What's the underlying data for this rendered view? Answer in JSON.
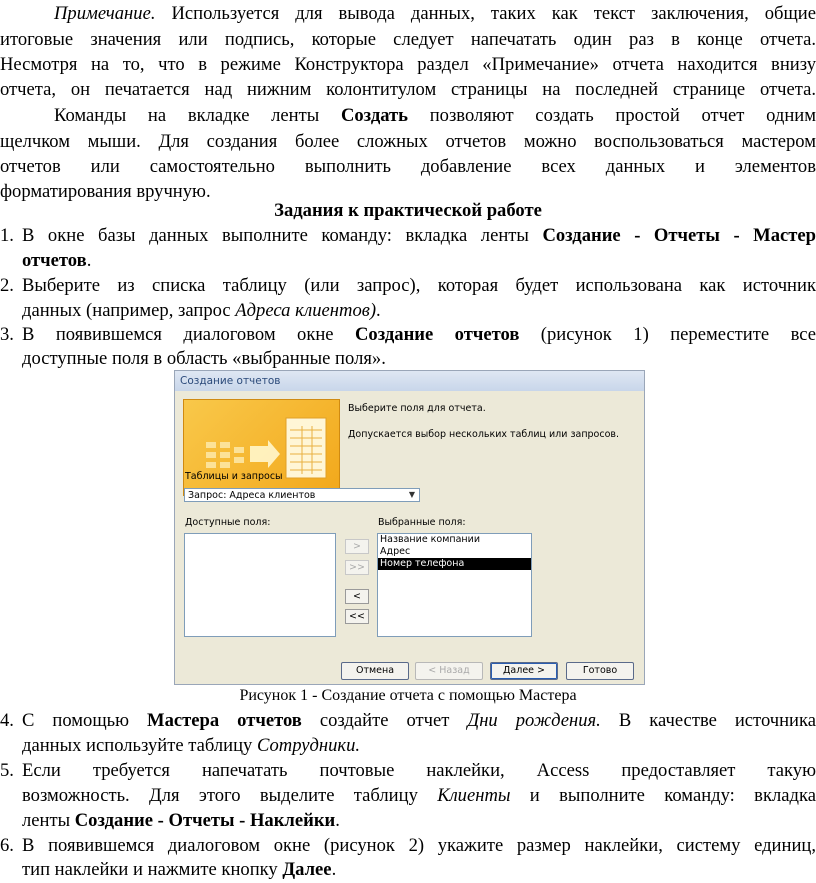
{
  "note": {
    "l1a": "Примечание.",
    "l1b": " Используется для вывода данных, таких как текст заключения, общие",
    "l2": "итоговые значения или подпись, которые следует напечатать один раз в конце отчета.",
    "l3": "Несмотря на то, что в режиме Конструктора раздел «Примечание» отчета находится внизу",
    "l4": "отчета, он печатается над нижним колонтитулом страницы на последней странице отчета."
  },
  "commands": {
    "l1a": "Команды на вкладке ленты ",
    "l1b": "Создать",
    "l1c": " позволяют создать простой отчет одним",
    "l2": "щелчком мыши. Для создания более сложных отчетов можно воспользоваться мастером",
    "l3": "отчетов или самостоятельно выполнить добавление всех данных и элементов",
    "l4": "форматирования вручную."
  },
  "section_title": "Задания к практической работе",
  "items": [
    {
      "num": "1.",
      "a": "В окне базы данных выполните команду: вкладка ленты ",
      "b": "Создание - Отчеты - Мастер",
      "c": "отчетов",
      "d": "."
    },
    {
      "num": "2.",
      "a": "Выберите из списка таблицу (или запрос), которая будет использована как источник",
      "b": "данных (например, запрос ",
      "c": "Адреса клиентов)",
      "d": "."
    },
    {
      "num": "3.",
      "a": "В появившемся диалоговом окне ",
      "b": "Создание отчетов",
      "c": " (рисунок 1) переместите все",
      "d": "доступные поля в область «выбранные поля»."
    },
    {
      "num": "4.",
      "a": "С помощью ",
      "b": "Мастера отчетов",
      "c": " создайте отчет ",
      "d": "Дни рождения.",
      "e": " В качестве источника",
      "f": "данных используйте таблицу ",
      "g": "Сотрудники."
    },
    {
      "num": "5.",
      "a": "Если требуется напечатать почтовые наклейки, Access предоставляет такую",
      "b": "возможность. Для этого выделите таблицу ",
      "c": "Клиенты",
      "d": " и выполните команду: вкладка",
      "e": "ленты ",
      "f": "Создание - Отчеты - Наклейки",
      "g": "."
    },
    {
      "num": "6.",
      "a": "В появившемся диалоговом окне (рисунок 2) укажите размер наклейки, систему единиц,",
      "b": "тип наклейки и нажмите кнопку ",
      "c": "Далее",
      "d": "."
    }
  ],
  "dialog": {
    "title": "Создание отчетов",
    "prompt1": "Выберите поля для отчета.",
    "prompt2": "Допускается выбор нескольких таблиц или запросов.",
    "tables_label": "Таблицы и запросы",
    "combo_value": "Запрос: Адреса клиентов",
    "available_label": "Доступные поля:",
    "selected_label": "Выбранные поля:",
    "selected_fields": [
      "Название компании",
      "Адрес",
      "Номер телефона"
    ],
    "selected_index": 2,
    "btn_add": ">",
    "btn_add_all": ">>",
    "btn_remove": "<",
    "btn_remove_all": "<<",
    "btn_cancel": "Отмена",
    "btn_back": "< Назад",
    "btn_next": "Далее >",
    "btn_finish": "Готово"
  },
  "caption": "Рисунок 1 - Создание отчета с помощью Мастера"
}
